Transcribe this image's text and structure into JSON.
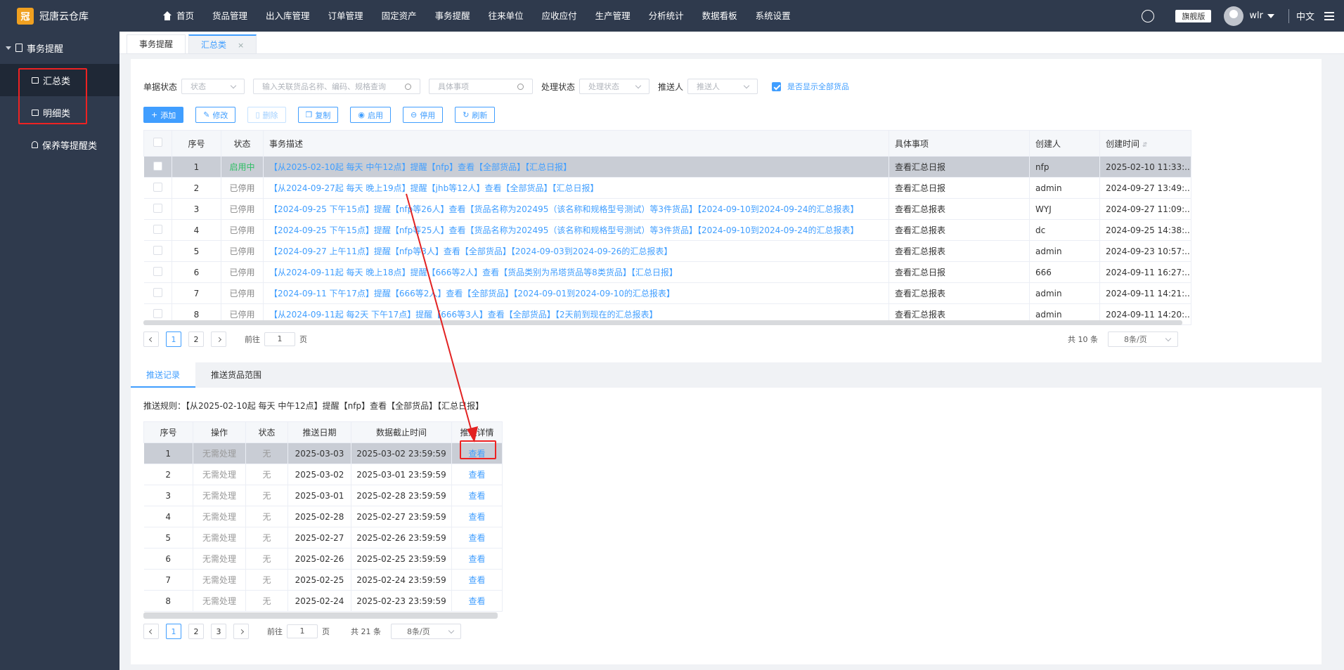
{
  "app": {
    "name": "冠唐云仓库",
    "logo_glyph": "冠"
  },
  "topnav": [
    {
      "label": "首页",
      "icon": "home-icon"
    },
    {
      "label": "货品管理"
    },
    {
      "label": "出入库管理"
    },
    {
      "label": "订单管理"
    },
    {
      "label": "固定资产"
    },
    {
      "label": "事务提醒"
    },
    {
      "label": "往来单位"
    },
    {
      "label": "应收应付"
    },
    {
      "label": "生产管理"
    },
    {
      "label": "分析统计"
    },
    {
      "label": "数据看板"
    },
    {
      "label": "系统设置"
    }
  ],
  "topright": {
    "edition": "旗舰版",
    "user": "wlr",
    "lang": "中文"
  },
  "sidebar": {
    "parent": "事务提醒",
    "items": [
      {
        "label": "汇总类",
        "icon": "summary-icon"
      },
      {
        "label": "明细类",
        "icon": "detail-icon"
      },
      {
        "label": "保养等提醒类",
        "icon": "bell-icon"
      }
    ]
  },
  "tabs": [
    {
      "label": "事务提醒"
    },
    {
      "label": "汇总类",
      "close": "×"
    }
  ],
  "filters": {
    "doc_status_label": "单据状态",
    "doc_status_placeholder": "状态",
    "goods_placeholder": "输入关联货品名称、编码、规格查询",
    "item_placeholder": "具体事项",
    "proc_status_label": "处理状态",
    "proc_status_placeholder": "处理状态",
    "pusher_label": "推送人",
    "pusher_placeholder": "推送人",
    "show_all_label": "是否显示全部货品",
    "show_all_checked": true
  },
  "toolbar": {
    "add": "添加",
    "edit": "修改",
    "delete": "删除",
    "copy": "复制",
    "enable": "启用",
    "disable": "停用",
    "refresh": "刷新"
  },
  "table1": {
    "headers": {
      "seq": "序号",
      "status": "状态",
      "desc": "事务描述",
      "item": "具体事项",
      "creator": "创建人",
      "created": "创建时间"
    },
    "rows": [
      {
        "seq": "1",
        "status": "启用中",
        "desc": "【从2025-02-10起 每天 中午12点】提醒【nfp】查看【全部货品】【汇总日报】",
        "item": "查看汇总日报",
        "creator": "nfp",
        "created": "2025-02-10 11:33:..."
      },
      {
        "seq": "2",
        "status": "已停用",
        "desc": "【从2024-09-27起 每天 晚上19点】提醒【jhb等12人】查看【全部货品】【汇总日报】",
        "item": "查看汇总日报",
        "creator": "admin",
        "created": "2024-09-27 13:49:..."
      },
      {
        "seq": "3",
        "status": "已停用",
        "desc": "【2024-09-25 下午15点】提醒【nfp等26人】查看【货品名称为202495（该名称和规格型号测试）等3件货品】【2024-09-10到2024-09-24的汇总报表】",
        "item": "查看汇总报表",
        "creator": "WYJ",
        "created": "2024-09-27 11:09:..."
      },
      {
        "seq": "4",
        "status": "已停用",
        "desc": "【2024-09-25 下午15点】提醒【nfp等25人】查看【货品名称为202495（该名称和规格型号测试）等3件货品】【2024-09-10到2024-09-24的汇总报表】",
        "item": "查看汇总报表",
        "creator": "dc",
        "created": "2024-09-25 14:38:..."
      },
      {
        "seq": "5",
        "status": "已停用",
        "desc": "【2024-09-27 上午11点】提醒【nfp等3人】查看【全部货品】【2024-09-03到2024-09-26的汇总报表】",
        "item": "查看汇总报表",
        "creator": "admin",
        "created": "2024-09-23 10:57:..."
      },
      {
        "seq": "6",
        "status": "已停用",
        "desc": "【从2024-09-11起 每天 晚上18点】提醒【666等2人】查看【货品类别为吊塔货品等8类货品】【汇总日报】",
        "item": "查看汇总日报",
        "creator": "666",
        "created": "2024-09-11 16:27:..."
      },
      {
        "seq": "7",
        "status": "已停用",
        "desc": "【2024-09-11 下午17点】提醒【666等2人】查看【全部货品】【2024-09-01到2024-09-10的汇总报表】",
        "item": "查看汇总报表",
        "creator": "admin",
        "created": "2024-09-11 14:21:..."
      },
      {
        "seq": "8",
        "status": "已停用",
        "desc": "【从2024-09-11起 每2天 下午17点】提醒【666等3人】查看【全部货品】【2天前到现在的汇总报表】",
        "item": "查看汇总报表",
        "creator": "admin",
        "created": "2024-09-11 14:20:..."
      }
    ]
  },
  "pager1": {
    "pages": [
      "1",
      "2"
    ],
    "goto_label": "前往",
    "goto_value": "1",
    "page_unit": "页",
    "total": "共 10 条",
    "page_size": "8条/页"
  },
  "subtabs": [
    {
      "label": "推送记录"
    },
    {
      "label": "推送货品范围"
    }
  ],
  "rule": "推送规则：【从2025-02-10起 每天 中午12点】提醒【nfp】查看【全部货品】【汇总日报】",
  "table2": {
    "headers": {
      "seq": "序号",
      "op": "操作",
      "status": "状态",
      "date": "推送日期",
      "cutoff": "数据截止时间",
      "detail": "推送详情"
    },
    "rows": [
      {
        "seq": "1",
        "op": "无需处理",
        "status": "无",
        "date": "2025-03-03",
        "cutoff": "2025-03-02 23:59:59",
        "detail": "查看"
      },
      {
        "seq": "2",
        "op": "无需处理",
        "status": "无",
        "date": "2025-03-02",
        "cutoff": "2025-03-01 23:59:59",
        "detail": "查看"
      },
      {
        "seq": "3",
        "op": "无需处理",
        "status": "无",
        "date": "2025-03-01",
        "cutoff": "2025-02-28 23:59:59",
        "detail": "查看"
      },
      {
        "seq": "4",
        "op": "无需处理",
        "status": "无",
        "date": "2025-02-28",
        "cutoff": "2025-02-27 23:59:59",
        "detail": "查看"
      },
      {
        "seq": "5",
        "op": "无需处理",
        "status": "无",
        "date": "2025-02-27",
        "cutoff": "2025-02-26 23:59:59",
        "detail": "查看"
      },
      {
        "seq": "6",
        "op": "无需处理",
        "status": "无",
        "date": "2025-02-26",
        "cutoff": "2025-02-25 23:59:59",
        "detail": "查看"
      },
      {
        "seq": "7",
        "op": "无需处理",
        "status": "无",
        "date": "2025-02-25",
        "cutoff": "2025-02-24 23:59:59",
        "detail": "查看"
      },
      {
        "seq": "8",
        "op": "无需处理",
        "status": "无",
        "date": "2025-02-24",
        "cutoff": "2025-02-23 23:59:59",
        "detail": "查看"
      }
    ]
  },
  "pager2": {
    "pages": [
      "1",
      "2",
      "3"
    ],
    "goto_label": "前往",
    "goto_value": "1",
    "page_unit": "页",
    "total": "共 21 条",
    "page_size": "8条/页"
  },
  "colors": {
    "accent": "#409eff",
    "topbar": "#2f3a4d",
    "annotation": "#e22222",
    "enabled": "#2fbd65"
  }
}
